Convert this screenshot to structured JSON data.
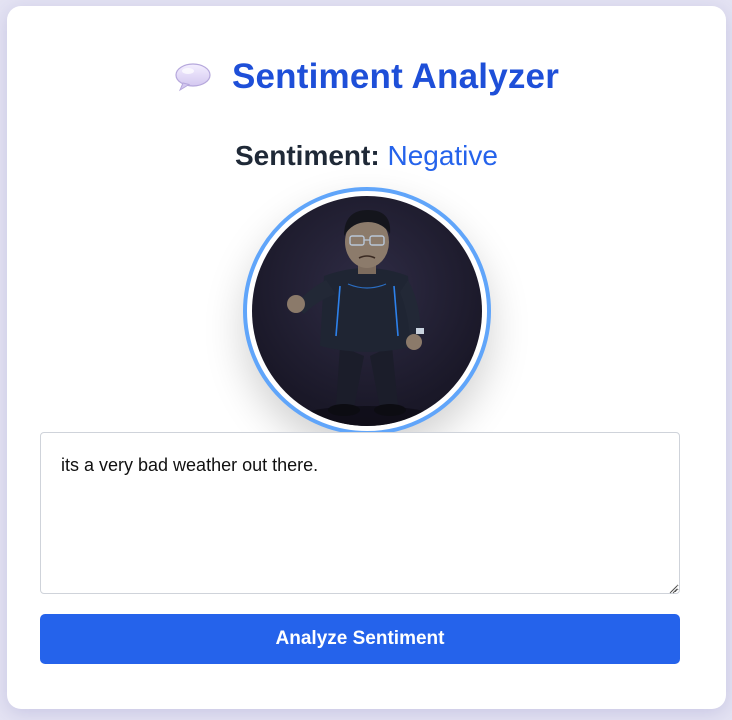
{
  "app": {
    "title": "Sentiment Analyzer",
    "title_icon": "speech-balloon-icon"
  },
  "result": {
    "label": "Sentiment:",
    "value": "Negative"
  },
  "avatar": {
    "description_icon": "sad-character-avatar"
  },
  "input": {
    "value": "its a very bad weather out there.",
    "placeholder": ""
  },
  "actions": {
    "analyze_label": "Analyze Sentiment"
  },
  "colors": {
    "accent": "#2563eb",
    "title": "#1e4fd8",
    "ring": "#60a5fa",
    "background": "#e4e3f3"
  }
}
